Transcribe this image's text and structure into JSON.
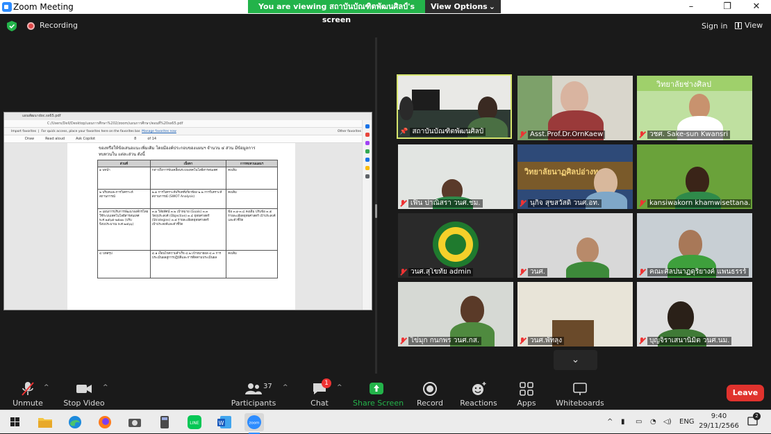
{
  "window": {
    "title": "Zoom Meeting",
    "minimize": "–",
    "restore": "❐",
    "close": "✕"
  },
  "banner": {
    "message": "You are viewing สถาบันบัณฑิตพัฒนศิลป์'s screen",
    "options_label": "View Options",
    "options_caret": "⌄"
  },
  "meeting_header": {
    "recording_label": "Recording",
    "signin_label": "Sign in",
    "view_label": "View"
  },
  "shared_screen": {
    "tab_title": "แผนพัฒนาdoc.ss65.pdf",
    "address": "C:/Users/Dell/Desktop/แผนการศึกษา%202/zoom/แผนการศึกษา/ตอนที่%20ss65.pdf",
    "favorites_hint": "For quick access, place your favorites here on the favorites bar.",
    "favorites_link": "Manage favorites now",
    "import_label": "Import favorites",
    "other_favorites": "Other favorites",
    "pdf_tools": [
      "Draw",
      "Read aloud",
      "Ask Copilot"
    ],
    "page_number": "8",
    "page_total": "of 14",
    "intro_text": "ของหรือให้ข้อเสนอแนะเพิ่มเติม โดยมีองค์ประกอบของแผนฯ จำนวน ๔ ส่วน มีข้อมูลการทบทวนใน แต่ละส่วน ดังนี้",
    "table": {
      "headers": [
        "ส่วนที่",
        "เนื้อหา",
        "การทบทวนแผนฯ"
      ],
      "rows": [
        [
          "๑ บทนำ",
          "กล่าวถึงการขับเคลื่อนระบบเทคโนโลยีสารสนเทศ",
          "คงเดิม"
        ],
        [
          "๒ บริบทและการวิเคราะห์สถานการณ์",
          "๒.๑ การวิเคราะห์บริบทที่เกี่ยวข้อง ๒.๒ การวิเคราะห์สถานการณ์ (SWOT Analysis)",
          "คงเดิม"
        ],
        [
          "๓ แผนการปรับการพัฒนาองค์กรโดยใช้ระบบเทคโนโลยีสารสนเทศ พ.ศ.๒๕๖๕-๒๕๗๐ (ปรับปีงบประมาณ พ.ศ.๒๕๖๖)",
          "๓.๑ วิสัยทัศน์ ๓.๒ เป้าหมาย (Goals) ๓.๓ วัตถุประสงค์ (Objective) ๓.๔ ยุทธศาสตร์ (Strategies) ๓.๕ รายละเอียดยุทธศาสตร์ เป้าประสงค์และตัวชี้วัด",
          "ข้อ ๓.๑-๓.๔ คงเดิม ปรับข้อ ๓.๕ รายละเอียดยุทธศาสตร์ เป้าประสงค์และตัวชี้วัด"
        ],
        [
          "๔ บทสรุป",
          "๔.๑ เงื่อนไขความสำเร็จ ๔.๒ เป้าหมายผล ๔.๓ การประเมินผลสู่การปฏิบัติและการติดตามประเมินผล",
          "คงเดิม"
        ]
      ]
    }
  },
  "participants": [
    {
      "name": "สถาบันบัณฑิตพัฒนศิลป์",
      "muted": false,
      "pinned": true,
      "active": true
    },
    {
      "name": "Asst.Prof.Dr.OrnKaew",
      "muted": true
    },
    {
      "name": "วชศ. Sake-sun Kwansri",
      "muted": true,
      "overlay_text": "วิทยาลัยช่างศิลป"
    },
    {
      "name": "เฟิน ปาณิสรา วนศ.ชม.",
      "muted": true
    },
    {
      "name": "นุกิจ สุขสวัสดิ์ วนศ.อท.",
      "muted": true,
      "overlay_text": "วิทยาลัยนาฏศิลปอ่างทอง"
    },
    {
      "name": "kansiwakorn khamwisettana...",
      "muted": true
    },
    {
      "name": "วนศ.สุโขทัย admin",
      "muted": true
    },
    {
      "name": "วนศ.",
      "muted": true
    },
    {
      "name": "คณะศิลปนาฏดุริยางค์ แพนธรรร์",
      "muted": true
    },
    {
      "name": "ไข่มุก กนกพร วนศ.กส.",
      "muted": true
    },
    {
      "name": "วนศ.พัทลุง",
      "muted": true
    },
    {
      "name": "บุญจิราเสนานิมิต วนศ.นม.",
      "muted": true
    }
  ],
  "toolbar": {
    "unmute": "Unmute",
    "stop_video": "Stop Video",
    "participants": "Participants",
    "participant_count": "37",
    "chat": "Chat",
    "chat_badge": "1",
    "share_screen": "Share Screen",
    "record": "Record",
    "reactions": "Reactions",
    "apps": "Apps",
    "whiteboards": "Whiteboards",
    "leave": "Leave",
    "scroll_down": "⌄"
  },
  "taskbar": {
    "apps": [
      "windows-start",
      "file-explorer",
      "edge",
      "firefox",
      "camera",
      "calculator",
      "line",
      "word",
      "zoom"
    ],
    "language": "ENG",
    "time": "9:40",
    "date": "29/11/2566",
    "notification_count": "2"
  },
  "colors": {
    "zoom_blue": "#2d8cff",
    "share_green": "#23b34a",
    "leave_red": "#e0322d",
    "active_speaker": "#d6e56d"
  }
}
